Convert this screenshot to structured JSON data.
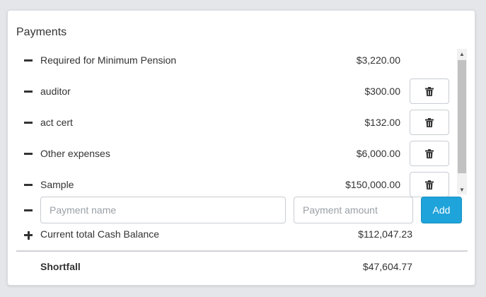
{
  "panel": {
    "title": "Payments"
  },
  "payments": [
    {
      "label": "Required for Minimum Pension",
      "amount": "$3,220.00",
      "deletable": false
    },
    {
      "label": "auditor",
      "amount": "$300.00",
      "deletable": true
    },
    {
      "label": "act cert",
      "amount": "$132.00",
      "deletable": true
    },
    {
      "label": "Other expenses",
      "amount": "$6,000.00",
      "deletable": true
    },
    {
      "label": "Sample",
      "amount": "$150,000.00",
      "deletable": true
    }
  ],
  "new_payment": {
    "name_placeholder": "Payment name",
    "amount_placeholder": "Payment amount",
    "add_label": "Add"
  },
  "cash_balance": {
    "label": "Current total Cash Balance",
    "amount": "$112,047.23"
  },
  "shortfall": {
    "label": "Shortfall",
    "amount": "$47,604.77"
  },
  "icons": {
    "remove": "minus-icon",
    "add": "plus-icon",
    "delete": "trash-icon"
  },
  "colors": {
    "accent": "#1ea3da"
  }
}
